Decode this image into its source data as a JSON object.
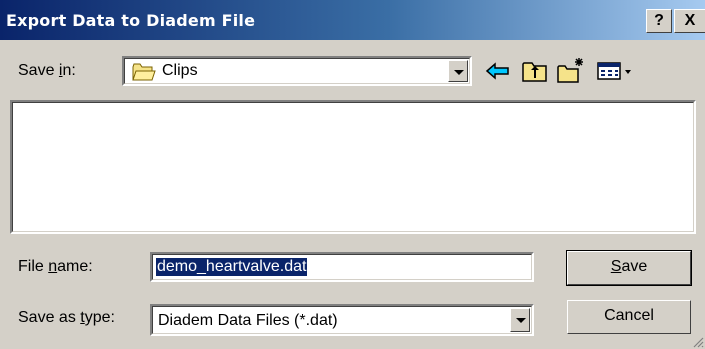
{
  "window": {
    "title": "Export Data to Diadem File",
    "help_label": "?",
    "close_label": "X"
  },
  "save_in": {
    "label_pre": "Save ",
    "label_hotkey": "i",
    "label_post": "n:",
    "folder": "Clips"
  },
  "toolbar": {
    "back_icon": "back-arrow-icon",
    "up_icon": "up-folder-icon",
    "new_folder_icon": "new-folder-icon",
    "view_menu_icon": "view-menu-icon"
  },
  "file_name": {
    "label_pre": "File ",
    "label_hotkey": "n",
    "label_post": "ame:",
    "value": "demo_heartvalve.dat"
  },
  "save_as_type": {
    "label_pre": "Save as ",
    "label_hotkey": "t",
    "label_post": "ype:",
    "value": "Diadem Data Files (*.dat)"
  },
  "buttons": {
    "save_hotkey": "S",
    "save_rest": "ave",
    "cancel": "Cancel"
  },
  "colors": {
    "title_start": "#0a246a",
    "title_end": "#a6caf0",
    "face": "#d4d0c8"
  }
}
